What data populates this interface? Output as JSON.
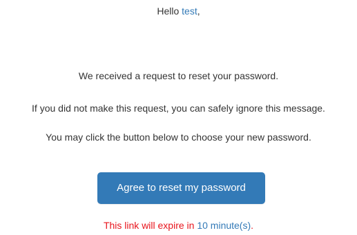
{
  "greeting": {
    "prefix": "Hello ",
    "username": "test",
    "suffix": ","
  },
  "messages": {
    "intro": "We received a request to reset your password.",
    "ignore": "If you did not make this request, you can safely ignore this message.",
    "instruct": "You may click the button below to choose your new password."
  },
  "button": {
    "label": "Agree to reset my password"
  },
  "expiry": {
    "prefix": "This link will expire in ",
    "duration": "10 minute(s)",
    "suffix": "."
  },
  "colors": {
    "accent": "#337ab7",
    "warning": "#e8141c",
    "text": "#333333",
    "background": "#ffffff"
  }
}
